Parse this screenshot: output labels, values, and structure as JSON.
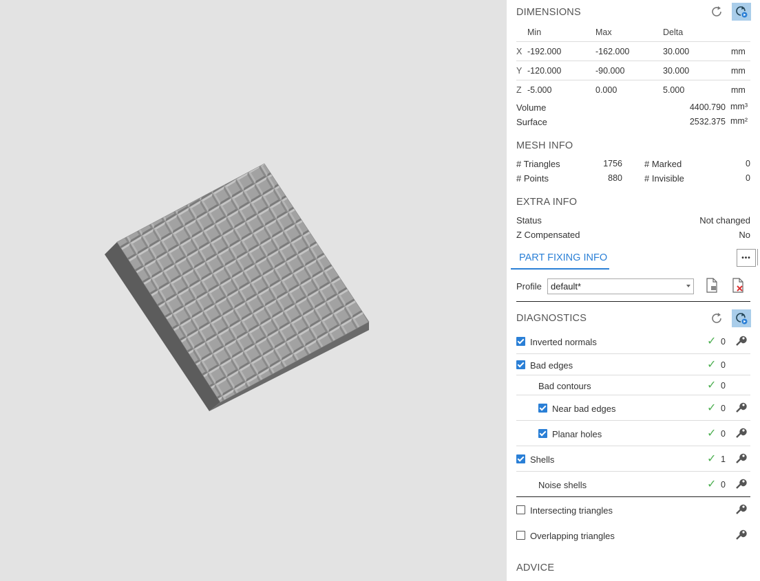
{
  "dimensions": {
    "title": "DIMENSIONS",
    "headers": {
      "min": "Min",
      "max": "Max",
      "delta": "Delta"
    },
    "rows": [
      {
        "axis": "X",
        "min": "-192.000",
        "max": "-162.000",
        "delta": "30.000",
        "unit": "mm"
      },
      {
        "axis": "Y",
        "min": "-120.000",
        "max": "-90.000",
        "delta": "30.000",
        "unit": "mm"
      },
      {
        "axis": "Z",
        "min": "-5.000",
        "max": "0.000",
        "delta": "5.000",
        "unit": "mm"
      }
    ],
    "volume": {
      "label": "Volume",
      "value": "4400.790",
      "unit": "mm³"
    },
    "surface": {
      "label": "Surface",
      "value": "2532.375",
      "unit": "mm²"
    }
  },
  "mesh_info": {
    "title": "MESH INFO",
    "triangles": {
      "label": "# Triangles",
      "value": "1756"
    },
    "points": {
      "label": "# Points",
      "value": "880"
    },
    "marked": {
      "label": "# Marked",
      "value": "0"
    },
    "invisible": {
      "label": "# Invisible",
      "value": "0"
    }
  },
  "extra_info": {
    "title": "EXTRA INFO",
    "status": {
      "label": "Status",
      "value": "Not changed"
    },
    "z_compensated": {
      "label": "Z Compensated",
      "value": "No"
    }
  },
  "part_fixing": {
    "tab_label": "PART FIXING INFO",
    "more_label": "•••",
    "profile_label": "Profile",
    "profile_value": "default*"
  },
  "diagnostics": {
    "title": "DIAGNOSTICS",
    "items": [
      {
        "label": "Inverted normals",
        "count": "0",
        "checked": true
      },
      {
        "label": "Bad edges",
        "count": "0",
        "checked": true
      },
      {
        "label": "Bad contours",
        "count": "0"
      },
      {
        "label": "Near bad edges",
        "count": "0",
        "checked": true
      },
      {
        "label": "Planar holes",
        "count": "0",
        "checked": true
      },
      {
        "label": "Shells",
        "count": "1",
        "checked": true
      },
      {
        "label": "Noise shells",
        "count": "0"
      },
      {
        "label": "Intersecting triangles",
        "checked": false
      },
      {
        "label": "Overlapping triangles",
        "checked": false
      }
    ],
    "check_glyph": "✓"
  },
  "advice": {
    "title": "ADVICE"
  },
  "colors": {
    "accent": "#2a7fd6",
    "ok_green": "#4caf50",
    "viewport_bg": "#e3e3e3",
    "active_button": "#a9cdea"
  }
}
